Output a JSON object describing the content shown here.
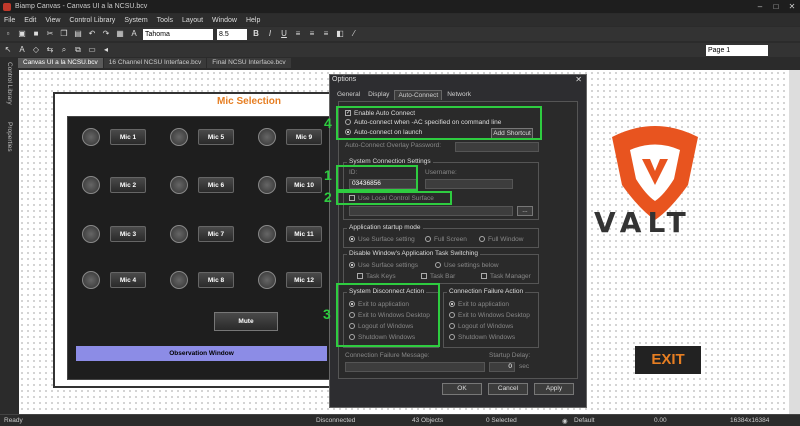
{
  "app": {
    "title": "Biamp Canvas - Canvas UI a la NCSU.bcv"
  },
  "menu": [
    "File",
    "Edit",
    "View",
    "Control Library",
    "System",
    "Tools",
    "Layout",
    "Window",
    "Help"
  ],
  "toolbar": {
    "font": "Tahoma",
    "size": "8.5",
    "page": "Page 1"
  },
  "doc_tabs": [
    "Canvas UI a la NCSU.bcv",
    "16 Channel NCSU Interface.bcv",
    "Final NCSU Interface.bcv"
  ],
  "sidebar": {
    "control_library": "Control Library",
    "properties": "Properties"
  },
  "canvas": {
    "mic_selection": "Mic Selection",
    "mics": [
      "Mic 1",
      "Mic 5",
      "Mic 9",
      "Mic 2",
      "Mic 6",
      "Mic 10",
      "Mic 3",
      "Mic 7",
      "Mic 11",
      "Mic 4",
      "Mic 8",
      "Mic 12"
    ],
    "mute": "Mute",
    "observation": "Observation Window",
    "valt": "VALT",
    "exit": "EXIT"
  },
  "dialog": {
    "title": "Options",
    "close": "✕",
    "tabs": [
      "General",
      "Display",
      "Auto-Connect",
      "Network"
    ],
    "enable_auto_connect": "Enable Auto Connect",
    "autoconnect_ac": "Auto-connect when -AC specified on command line",
    "autoconnect_launch": "Auto-connect on launch",
    "add_shortcut": "Add Shortcut",
    "overlay_password": "Auto-Connect Overlay Password:",
    "sys_conn_settings": "System Connection Settings",
    "id_label": "ID:",
    "id_value": "03436856",
    "username_label": "Username:",
    "use_local": "Use Local Control Surface",
    "browse": "...",
    "startup_mode": "Application startup mode",
    "startup_opts": [
      "Use Surface setting",
      "Full Screen",
      "Full Window"
    ],
    "disable_switching": "Disable Window's Application Task Switching",
    "switch_opts": [
      "Use Surface settings",
      "Use settings below"
    ],
    "task_opts": [
      "Task Keys",
      "Task Bar",
      "Task Manager"
    ],
    "sys_disc_action": "System Disconnect Action",
    "conn_fail_action": "Connection Failure Action",
    "action_opts": [
      "Exit to application",
      "Exit to Windows Desktop",
      "Logout of Windows",
      "Shutdown Windows"
    ],
    "conn_fail_msg": "Connection Failure Message:",
    "startup_delay": "Startup Delay:",
    "delay_val": "0",
    "delay_unit": "sec",
    "ok": "OK",
    "cancel": "Cancel",
    "apply": "Apply"
  },
  "annotations": [
    "4",
    "1",
    "2",
    "3"
  ],
  "status": {
    "ready": "Ready",
    "disconnected": "Disconnected",
    "objects": "43 Objects",
    "selected": "0 Selected",
    "default": "Default",
    "zero": "0.00",
    "size": "16384x16384"
  }
}
